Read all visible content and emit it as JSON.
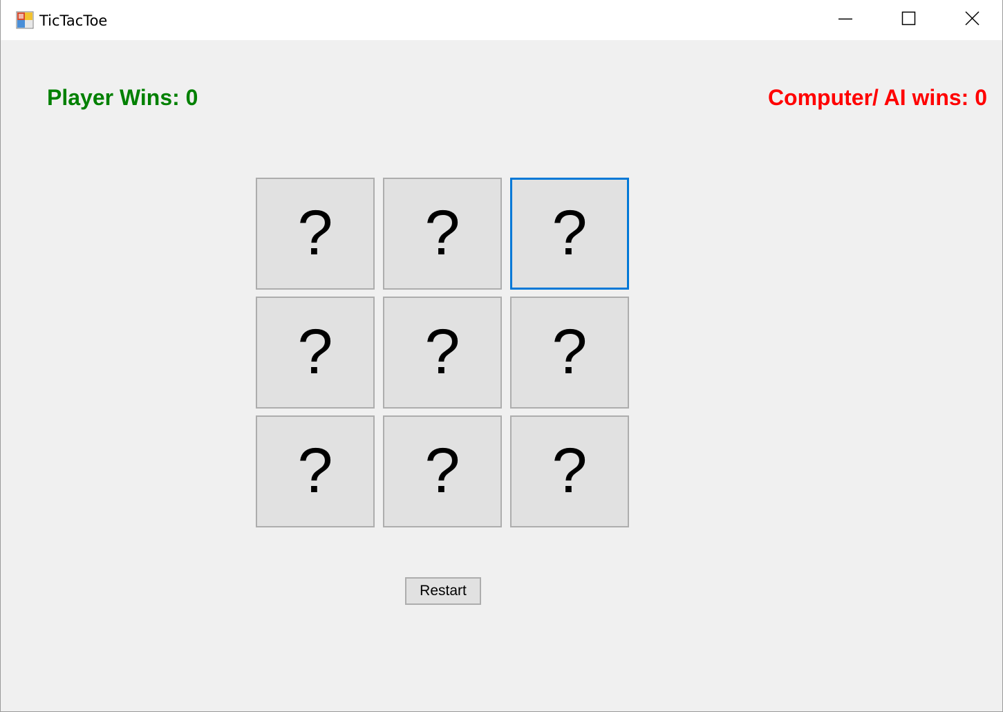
{
  "window": {
    "title": "TicTacToe",
    "icon": "app-window-icon",
    "controls": [
      "minimize-icon",
      "maximize-icon",
      "close-icon"
    ]
  },
  "scores": {
    "player_label": "Player Wins: 0",
    "player_color": "#008000",
    "computer_label": "Computer/ AI wins: 0",
    "computer_color": "#ff0000"
  },
  "board": {
    "cells": [
      "?",
      "?",
      "?",
      "?",
      "?",
      "?",
      "?",
      "?",
      "?"
    ],
    "focused_cell": 3,
    "focus_color": "#0078d7"
  },
  "restart": {
    "label": "Restart"
  },
  "colors": {
    "background": "#f0f0f0",
    "cell_face": "#e1e1e1",
    "cell_border": "#adadad"
  }
}
